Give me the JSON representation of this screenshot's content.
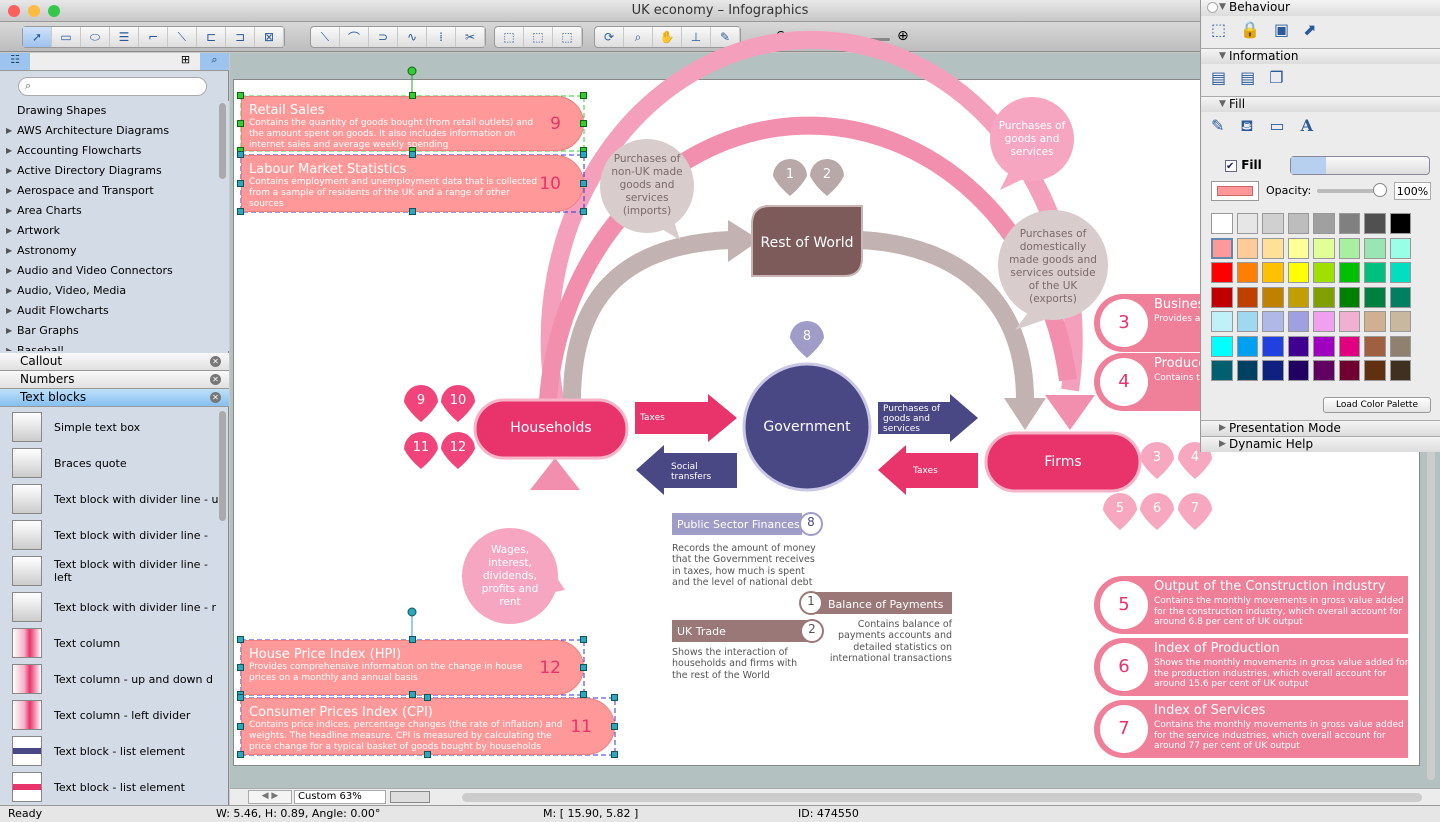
{
  "window": {
    "title": "UK economy – Infographics"
  },
  "sidebar": {
    "tree_items": [
      "Drawing Shapes",
      "AWS Architecture Diagrams",
      "Accounting Flowcharts",
      "Active Directory Diagrams",
      "Aerospace and Transport",
      "Area Charts",
      "Artwork",
      "Astronomy",
      "Audio and Video Connectors",
      "Audio, Video, Media",
      "Audit Flowcharts",
      "Bar Graphs",
      "Baseball"
    ],
    "sections": [
      {
        "label": "Callout"
      },
      {
        "label": "Numbers"
      },
      {
        "label": "Text blocks",
        "selected": true
      }
    ],
    "library_items": [
      "Simple text box",
      "Braces quote",
      "Text block with divider line - up",
      "Text block with divider line -",
      "Text block with divider line - left",
      "Text block with divider line - r",
      "Text column",
      "Text column - up and down d",
      "Text column - left divider",
      "Text block - list element",
      "Text block - list element"
    ]
  },
  "diagram": {
    "left_boxes": [
      {
        "title": "Retail Sales",
        "desc": "Contains the quantity of goods bought (from retail outlets) and the amount spent on goods. It also includes information on internet sales and average weekly spending",
        "num": "9"
      },
      {
        "title": "Labour Market Statistics",
        "desc": "Contains employment and unemployment data that is collected from a sample of residents of the UK and a range of other sources",
        "num": "10"
      },
      {
        "title": "House Price Index (HPI)",
        "desc": "Provides comprehensive information on the change in house prices on a monthly and annual basis",
        "num": "12"
      },
      {
        "title": "Consumer Prices Index (CPI)",
        "desc": "Contains price indices, percentage changes (the rate of inflation) and weights. The headline measure. CPI is measured by calculating the price change for a typical basket of goods bought by households",
        "num": "11"
      }
    ],
    "right_boxes": [
      {
        "num": "3",
        "title": "Business",
        "desc": "Provides a... assets, su... businesses"
      },
      {
        "num": "4",
        "title": "Produce",
        "desc": "Contains t... prices), an... (input pric..."
      },
      {
        "num": "5",
        "title": "Output of the Construction industry",
        "desc": "Contains the monthly movements in gross value added for the construction industry, which overall account for around 6.8 per cent of UK output"
      },
      {
        "num": "6",
        "title": "Index of Production",
        "desc": "Shows the monthly movements in gross value added for the production industries, which overall account for around 15.6 per cent of UK output"
      },
      {
        "num": "7",
        "title": "Index of Services",
        "desc": "Contains the monthly movements in gross value added for the service industries, which overall account for around 77 per cent of UK output"
      }
    ],
    "nodes": {
      "households": "Households",
      "government": "Government",
      "rest_of_world": "Rest of World",
      "firms": "Firms"
    },
    "arrows": {
      "taxes_h": "Taxes",
      "social": "Social transfers",
      "purchases": "Purchases of goods and services",
      "taxes_f": "Taxes"
    },
    "bubbles": {
      "imports": "Purchases of non-UK made goods and services (imports)",
      "purchases": "Purchases of goods and services",
      "exports": "Purchases of domestically made goods and services outside of the UK (exports)",
      "wages": "Wages, interest, dividends, profits and rent"
    },
    "markers": {
      "row_top": [
        "1",
        "2"
      ],
      "gov": "8",
      "households": [
        "9",
        "10",
        "11",
        "12"
      ],
      "firms": [
        "3",
        "4",
        "5",
        "6",
        "7"
      ]
    },
    "psf": {
      "title": "Public Sector Finances",
      "num": "8",
      "desc": "Records the amount of money that the Government receives in taxes, how much is spent and the level of national debt"
    },
    "bop": {
      "title": "Balance of Payments",
      "num": "1",
      "desc": "Contains balance of payments accounts and detailed statistics on international transactions"
    },
    "trade": {
      "title": "UK Trade",
      "num": "2",
      "desc": "Shows the interaction of households and firms with the rest of the World"
    }
  },
  "panel": {
    "behaviour": "Behaviour",
    "information": "Information",
    "fill": "Fill",
    "fill_checkbox": "Fill",
    "fill_checked": true,
    "fill_color": "#ff9999",
    "opacity_label": "Opacity:",
    "opacity": "100%",
    "load_palette": "Load Color Palette",
    "presentation": "Presentation Mode",
    "help": "Dynamic Help",
    "palette": [
      "#ffffff",
      "#e6e6e6",
      "#d0d0d0",
      "#bdbdbd",
      "#a0a0a0",
      "#808080",
      "#505050",
      "#000000",
      "#ff9999",
      "#ffcc99",
      "#ffe099",
      "#ffff99",
      "#e0ff99",
      "#a8f0a0",
      "#99e6b3",
      "#99ffe6",
      "#ff0000",
      "#ff8000",
      "#ffc000",
      "#ffff00",
      "#a0e000",
      "#00c000",
      "#00c080",
      "#00e0c0",
      "#c00000",
      "#c04000",
      "#c08000",
      "#c0a000",
      "#80a000",
      "#008000",
      "#008040",
      "#008060",
      "#c0f0f8",
      "#a0d8f0",
      "#b0b8e8",
      "#a0a0e0",
      "#f0a0f0",
      "#f0b0d0",
      "#d0b090",
      "#c8b8a0",
      "#00ffff",
      "#00a0f0",
      "#2040e0",
      "#400090",
      "#a000c0",
      "#e00080",
      "#a06040",
      "#908070",
      "#006070",
      "#004060",
      "#102080",
      "#200060",
      "#600060",
      "#700030",
      "#603010",
      "#403020"
    ]
  },
  "canvas": {
    "zoom": "Custom 63%"
  },
  "status": {
    "state": "Ready",
    "dims": "W: 5.46,  H: 0.89,  Angle: 0.00°",
    "mouse": "M: [ 15.90, 5.82 ]",
    "id": "ID: 474550"
  },
  "colors": {
    "accent_pink": "#e8336b",
    "navy": "#4a4785",
    "brown": "#7d5b5b",
    "ring": "#f28fae",
    "salmon": "#ff9999"
  }
}
